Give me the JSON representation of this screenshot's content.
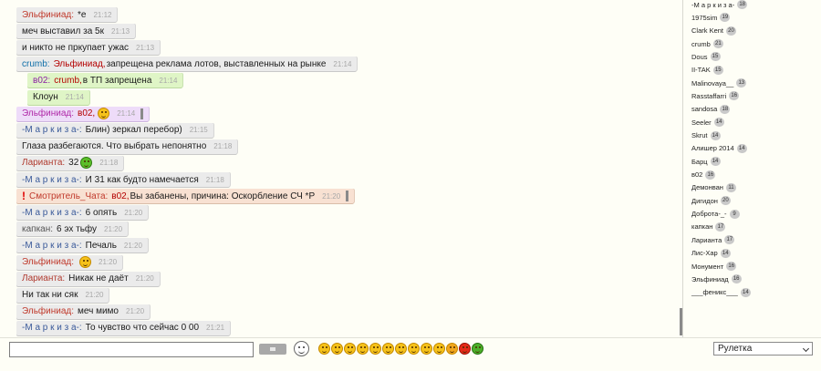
{
  "messages": [
    {
      "kind": "user",
      "nick": "Эльфиниад:",
      "nick_color": "#c0392b",
      "text": "*е",
      "time": "21:12"
    },
    {
      "kind": "user",
      "nick": "",
      "nick_color": "#000000",
      "text": "меч выставил за 5к",
      "time": "21:13"
    },
    {
      "kind": "user",
      "nick": "",
      "nick_color": "#000000",
      "text": "и никто не пркупает ужас",
      "time": "21:13"
    },
    {
      "kind": "user",
      "nick": "crumb:",
      "nick_color": "#0d6ea8",
      "target": "Эльфиниад,",
      "text": "запрещена реклама лотов, выставленных на рынке",
      "time": "21:14"
    },
    {
      "kind": "sys",
      "nick": "в02:",
      "nick_color": "#8a1fa3",
      "target": "crumb,",
      "text": "в ТП запрещена",
      "time": "21:14"
    },
    {
      "kind": "sys",
      "nick": "",
      "nick_color": "#000000",
      "text": "Клоун",
      "time": "21:14"
    },
    {
      "kind": "ping",
      "nick": "Эльфиниад:",
      "nick_color": "#b02aa8",
      "target": "в02,",
      "text": "",
      "time": "21:14",
      "smiley": "yellow",
      "bar": true
    },
    {
      "kind": "user",
      "nick": "-М а р к и з а-:",
      "nick_color": "#3a5a9a",
      "text": "Блин) зеркал перебор)",
      "time": "21:15"
    },
    {
      "kind": "user",
      "nick": "",
      "nick_color": "#000000",
      "text": "Глаза разбегаются. Что выбрать непонятно",
      "time": "21:18"
    },
    {
      "kind": "user",
      "nick": "Ларианта:",
      "nick_color": "#b03a2e",
      "text": "32",
      "time": "21:18",
      "smiley": "green"
    },
    {
      "kind": "user",
      "nick": "-М а р к и з а-:",
      "nick_color": "#3a5a9a",
      "text": "И 31 как будто намечается",
      "time": "21:18"
    },
    {
      "kind": "ban",
      "nick": "Смотритель_Чата:",
      "nick_color": "#c0392b",
      "target": "в02,",
      "text": "Вы забанены, причина: Оскорбление СЧ *Р",
      "time": "21:20",
      "bar": true,
      "mark": "!"
    },
    {
      "kind": "user",
      "nick": "-М а р к и з а-:",
      "nick_color": "#3a5a9a",
      "text": "6 опять",
      "time": "21:20"
    },
    {
      "kind": "user",
      "nick": "капкан:",
      "nick_color": "#555555",
      "text": "6 эх тьфу",
      "time": "21:20"
    },
    {
      "kind": "user",
      "nick": "-М а р к и з а-:",
      "nick_color": "#3a5a9a",
      "text": "Печаль",
      "time": "21:20"
    },
    {
      "kind": "user",
      "nick": "Эльфиниад:",
      "nick_color": "#c0392b",
      "text": "",
      "time": "21:20",
      "smiley": "cry"
    },
    {
      "kind": "user",
      "nick": "Ларианта:",
      "nick_color": "#b03a2e",
      "text": "Никак не даёт",
      "time": "21:20"
    },
    {
      "kind": "user",
      "nick": "",
      "nick_color": "#000000",
      "text": "Ни так ни сяк",
      "time": "21:20"
    },
    {
      "kind": "user",
      "nick": "Эльфиниад:",
      "nick_color": "#c0392b",
      "text": "меч мимо",
      "time": "21:20"
    },
    {
      "kind": "user",
      "nick": "-М а р к и з а-:",
      "nick_color": "#3a5a9a",
      "text": "То чувство что сейчас 0 00",
      "time": "21:21"
    }
  ],
  "users": [
    {
      "name": "-М а р к и з а-",
      "count": "18"
    },
    {
      "name": "1975sim",
      "count": "19"
    },
    {
      "name": "Clark Kent",
      "count": "20"
    },
    {
      "name": "crumb",
      "count": "21"
    },
    {
      "name": "Dous",
      "count": "15"
    },
    {
      "name": "II-TAK",
      "count": "15"
    },
    {
      "name": "Malinovaya__",
      "count": "13"
    },
    {
      "name": "Rasstaffarri",
      "count": "16"
    },
    {
      "name": "sandosa",
      "count": "18"
    },
    {
      "name": "Seeler",
      "count": "14"
    },
    {
      "name": "Skrut",
      "count": "14"
    },
    {
      "name": "Алишер 2014",
      "count": "14"
    },
    {
      "name": "Барц",
      "count": "14"
    },
    {
      "name": "в02",
      "count": "16"
    },
    {
      "name": "Демонван",
      "count": "11"
    },
    {
      "name": "Дигидон",
      "count": "20"
    },
    {
      "name": "Доброта-_-",
      "count": "9"
    },
    {
      "name": "капкан",
      "count": "17"
    },
    {
      "name": "Ларианта",
      "count": "17"
    },
    {
      "name": "Лис-Хар",
      "count": "14"
    },
    {
      "name": "Монумент",
      "count": "16"
    },
    {
      "name": "Эльфиниад",
      "count": "16"
    },
    {
      "name": "___феникс___",
      "count": "14"
    }
  ],
  "input": {
    "value": "",
    "placeholder": ""
  },
  "game_select": {
    "selected": "Рулетка"
  },
  "colors": {
    "sys_bg": "#dff5c6",
    "ping_bg": "#eedcf9",
    "ban_bg": "#f8e1d2",
    "msg_bg": "#ebebeb"
  }
}
